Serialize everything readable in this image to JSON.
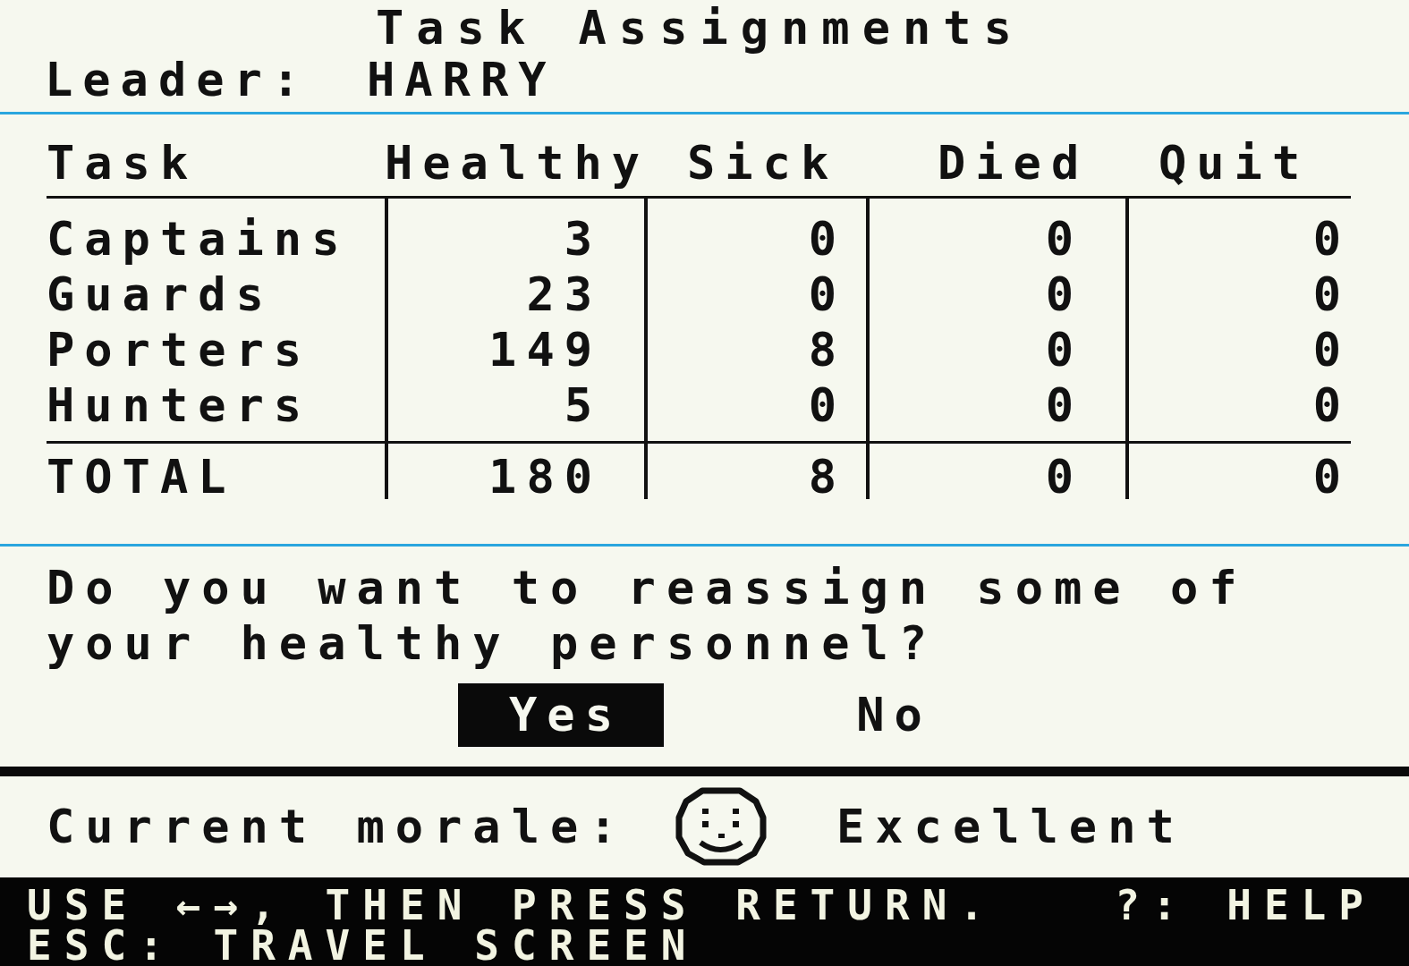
{
  "header": {
    "title": "Task Assignments",
    "leader_label": "Leader:",
    "leader_name": "HARRY"
  },
  "table": {
    "columns": [
      "Task",
      "Healthy",
      "Sick",
      "Died",
      "Quit"
    ],
    "rows": [
      {
        "task": "Captains",
        "healthy": "3",
        "sick": "0",
        "died": "0",
        "quit": "0"
      },
      {
        "task": "Guards",
        "healthy": "23",
        "sick": "0",
        "died": "0",
        "quit": "0"
      },
      {
        "task": "Porters",
        "healthy": "149",
        "sick": "8",
        "died": "0",
        "quit": "0"
      },
      {
        "task": "Hunters",
        "healthy": "5",
        "sick": "0",
        "died": "0",
        "quit": "0"
      }
    ],
    "total": {
      "task": "TOTAL",
      "healthy": "180",
      "sick": "8",
      "died": "0",
      "quit": "0"
    }
  },
  "prompt": {
    "question": "Do you want to reassign some of your healthy personnel?",
    "options": [
      {
        "label": "Yes",
        "selected": true
      },
      {
        "label": "No",
        "selected": false
      }
    ]
  },
  "morale": {
    "label": "Current morale:",
    "value": "Excellent"
  },
  "status_bar": {
    "instruction": "USE ←→, THEN PRESS RETURN.",
    "help": "?: HELP",
    "escape": "ESC: TRAVEL SCREEN"
  }
}
